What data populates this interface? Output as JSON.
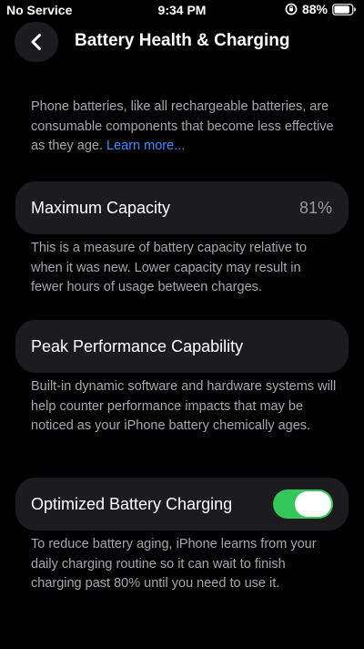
{
  "status_bar": {
    "carrier": "No Service",
    "time": "9:34 PM",
    "battery_percent": "88%",
    "battery_level": 0.88
  },
  "nav": {
    "title": "Battery Health & Charging"
  },
  "intro": {
    "text": "Phone batteries, like all rechargeable batteries, are consumable components that become less effective as they age.",
    "link": "Learn more..."
  },
  "max_capacity": {
    "label": "Maximum Capacity",
    "value": "81%",
    "description": "This is a measure of battery capacity relative to when it was new. Lower capacity may result in fewer hours of usage between charges."
  },
  "peak_performance": {
    "label": "Peak Performance Capability",
    "description": "Built-in dynamic software and hardware systems will help counter performance impacts that may be noticed as your iPhone battery chemically ages."
  },
  "optimized_charging": {
    "label": "Optimized Battery Charging",
    "enabled": true,
    "description": "To reduce battery aging, iPhone learns from your daily charging routine so it can wait to finish charging past 80% until you need to use it."
  },
  "colors": {
    "background": "#000000",
    "cell_background": "#1c1c1e",
    "secondary_text": "#a6a6ac",
    "link": "#3b8cff",
    "toggle_on": "#34c759"
  },
  "icons": {
    "back": "chevron-left-icon",
    "rotation_lock": "rotation-lock-icon",
    "battery": "battery-icon"
  }
}
